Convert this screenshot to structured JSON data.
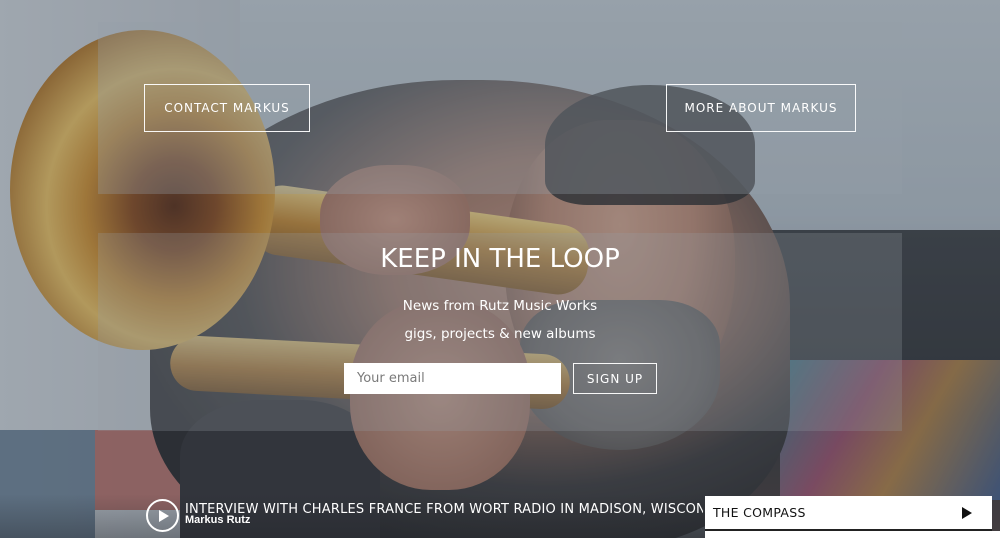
{
  "hero": {
    "background_icon": "trumpet-player-photo"
  },
  "top_buttons": {
    "contact_label": "CONTACT MARKUS",
    "more_label": "MORE ABOUT MARKUS"
  },
  "newsletter": {
    "title": "KEEP IN THE LOOP",
    "line1": "News from Rutz Music Works",
    "line2": "gigs, projects & new albums",
    "email_placeholder": "Your email",
    "signup_label": "SIGN UP"
  },
  "player": {
    "play_icon": "play-icon",
    "track_title": "INTERVIEW WITH CHARLES FRANCE FROM WORT RADIO IN MADISON, WISCONSIN",
    "track_artist": "Markus Rutz",
    "playlist_item_label": "THE COMPASS",
    "playlist_item_icon": "play-icon"
  },
  "colors": {
    "overlay": "#3a424c",
    "button_border": "#ffffff",
    "text": "#ffffff",
    "playlist_bg": "#ffffff"
  }
}
